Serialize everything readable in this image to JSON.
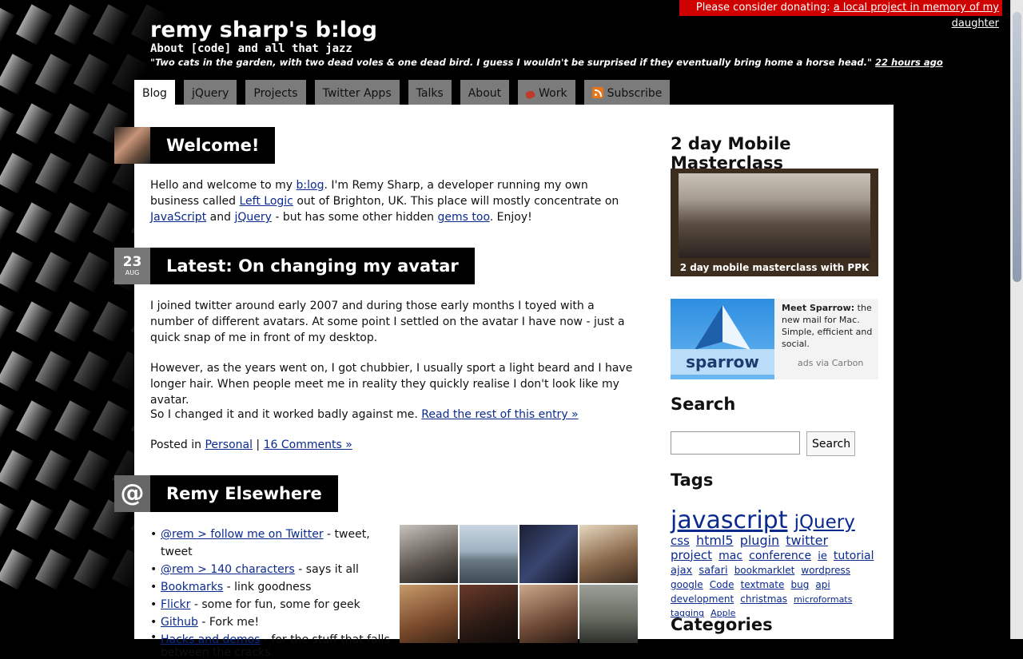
{
  "donate": {
    "text": "Please consider donating:",
    "link": "a local project in memory of my daughter"
  },
  "header": {
    "title": "remy sharp's b:log",
    "tagline": "About [code] and all that jazz",
    "tweet": "\"Two cats in the garden, with two dead voles & one dead bird. I guess I wouldn't be surprised if they eventually bring home a horse head.\"",
    "tweet_time": "22 hours ago"
  },
  "tabs": [
    "Blog",
    "jQuery",
    "Projects",
    "Twitter Apps",
    "Talks",
    "About",
    "Work",
    "Subscribe"
  ],
  "welcome": {
    "title": "Welcome!",
    "p1": "Hello and welcome to my ",
    "l1": "b:log",
    "p2": ". I'm Remy Sharp, a developer running my own business called ",
    "l2": "Left Logic",
    "p3": " out of Brighton, UK. This place will mostly concentrate on ",
    "l3": "JavaScript",
    "p4": " and ",
    "l4": "jQuery",
    "p5": " - but has some other hidden ",
    "l5": "gems too",
    "p6": ". Enjoy!"
  },
  "latest": {
    "day": "23",
    "month": "AUG",
    "title": "Latest: On changing my avatar",
    "para1": "I joined twitter around early 2007 and during those early months I toyed with a number of different avatars. At some point I settled on the avatar I have now - just a quick snap of me in front of my desktop.",
    "para2": "However, as the years went on, I got chubbier, I usually sport a light beard and I have longer hair. When people meet me in reality they quickly realise I don't look like my avatar.",
    "para3": "So I changed it and it worked badly against me. ",
    "read_more": "Read the rest of this entry »",
    "posted_in": "Posted in ",
    "category": "Personal",
    "sep": " | ",
    "comments": "16 Comments »"
  },
  "elsewhere": {
    "tile": "@",
    "title": "Remy Elsewhere",
    "links": [
      {
        "link": "@rem > follow me on Twitter",
        "text": " - tweet, tweet"
      },
      {
        "link": "@rem > 140 characters",
        "text": " - says it all"
      },
      {
        "link": "Bookmarks",
        "text": " - link goodness"
      },
      {
        "link": "Flickr",
        "text": " - some for fun, some for geek"
      },
      {
        "link": "Github",
        "text": " - Fork me!"
      },
      {
        "link": "Hacks and demos",
        "text": " - for the stuff that falls between the cracks"
      }
    ]
  },
  "sidebar": {
    "masterclass_title": "2 day Mobile Masterclass",
    "masterclass_caption": "2 day mobile masterclass with PPK",
    "ad_brand": "sparrow",
    "ad_title": "Meet Sparrow:",
    "ad_text": " the new mail for Mac. Simple, efficient and social.",
    "ad_via": "ads via Carbon",
    "search_title": "Search",
    "search_button": "Search",
    "tags_title": "Tags",
    "tags": [
      {
        "t": "javascript",
        "s": 30
      },
      {
        "t": "jQuery",
        "s": 23
      },
      {
        "t": "css",
        "s": 15
      },
      {
        "t": "html5",
        "s": 16
      },
      {
        "t": "plugin",
        "s": 16
      },
      {
        "t": "twitter",
        "s": 16
      },
      {
        "t": "project",
        "s": 15
      },
      {
        "t": "mac",
        "s": 14
      },
      {
        "t": "conference",
        "s": 14
      },
      {
        "t": "ie",
        "s": 13
      },
      {
        "t": "tutorial",
        "s": 14
      },
      {
        "t": "ajax",
        "s": 13
      },
      {
        "t": "safari",
        "s": 13
      },
      {
        "t": "bookmarklet",
        "s": 12
      },
      {
        "t": "wordpress",
        "s": 12
      },
      {
        "t": "google",
        "s": 12
      },
      {
        "t": "Code",
        "s": 12
      },
      {
        "t": "textmate",
        "s": 12
      },
      {
        "t": "bug",
        "s": 12
      },
      {
        "t": "api",
        "s": 12
      },
      {
        "t": "development",
        "s": 12
      },
      {
        "t": "christmas",
        "s": 12
      },
      {
        "t": "microformats",
        "s": 11
      },
      {
        "t": "tagging",
        "s": 11
      },
      {
        "t": "Apple",
        "s": 11
      }
    ],
    "categories_title": "Categories"
  },
  "colors": {
    "donate_bg": "#cf0000",
    "link": "#0b2a8e",
    "tab_inactive": "#7b7b7b"
  }
}
